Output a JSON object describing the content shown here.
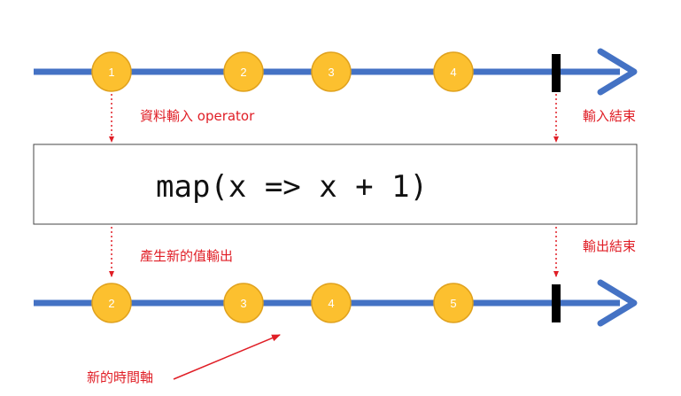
{
  "colors": {
    "timeline": "#4472c4",
    "marble_fill": "#fcc02f",
    "marble_stroke": "#e0a21e",
    "marble_text": "#ffffff",
    "annotation": "#e01e26",
    "complete_bar": "#000000",
    "operator_border": "#444444"
  },
  "input_stream": {
    "marbles": [
      "1",
      "2",
      "3",
      "4"
    ],
    "annotation_operator_input": "資料輸入 operator",
    "annotation_complete": "輸入結束"
  },
  "operator": {
    "label": "map(x => x + 1)"
  },
  "output_stream": {
    "marbles": [
      "2",
      "3",
      "4",
      "5"
    ],
    "annotation_new_values": "產生新的值輸出",
    "annotation_complete": "輸出結束",
    "annotation_new_timeline": "新的時間軸"
  }
}
